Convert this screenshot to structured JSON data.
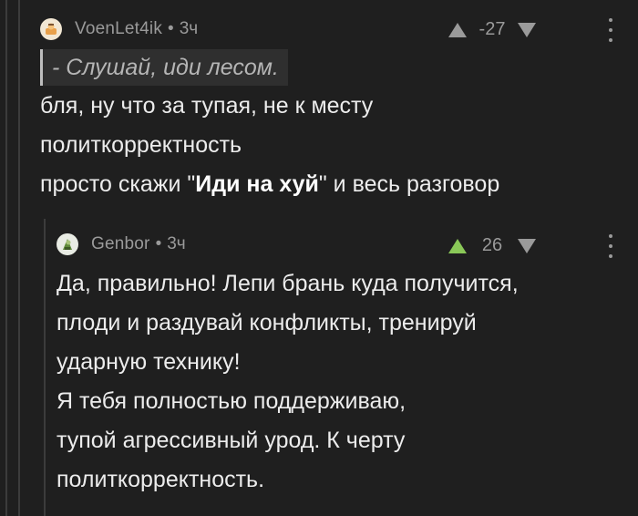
{
  "comment1": {
    "author": "VoenLet4ik",
    "separator": "•",
    "time": "3ч",
    "rating": "-27",
    "quote": "- Слушай, иди лесом.",
    "lines": [
      "бля, ну что за тупая, не к месту",
      "политкорректность"
    ],
    "last_line_before": "просто скажи \"",
    "last_line_bold": "Иди на хуй",
    "last_line_after": "\" и весь разговор"
  },
  "comment2": {
    "author": "Genbor",
    "separator": "•",
    "time": "3ч",
    "rating": "26",
    "lines": [
      "Да, правильно! Лепи брань куда получится,",
      "плоди и раздувай конфликты, тренируй",
      "ударную технику!",
      "Я тебя полностью поддерживаю,",
      "тупой агрессивный урод. К черту",
      "политкорректность."
    ]
  },
  "icons": {
    "upvote_neutral": "upvote-arrow-icon",
    "upvote_active": "upvote-arrow-icon",
    "downvote": "downvote-arrow-icon",
    "more": "more-vertical-icon",
    "avatar1": "avatar-icon",
    "avatar2": "avatar-icon"
  },
  "colors": {
    "background": "#1f1f1f",
    "text": "#ececec",
    "meta": "#9a9a9a",
    "upvote_active": "#8ac858",
    "quote_bg": "#2f2f2f"
  }
}
